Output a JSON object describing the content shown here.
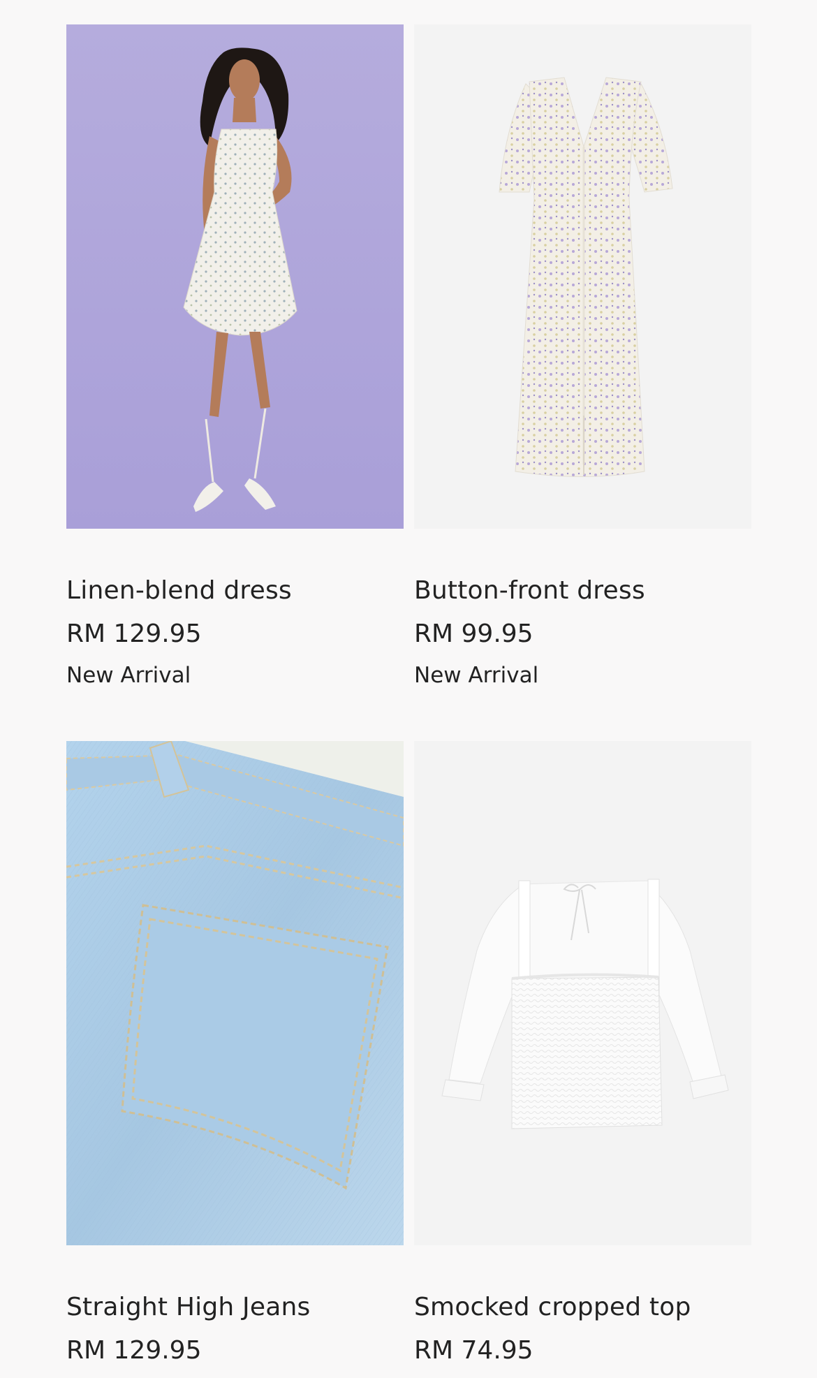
{
  "products": [
    {
      "name": "Linen-blend dress",
      "price": "RM 129.95",
      "badge": "New Arrival",
      "image_icon": "model-wearing-floral-dress-image",
      "image_bg": "#b8afdf"
    },
    {
      "name": "Button-front dress",
      "price": "RM 99.95",
      "badge": "New Arrival",
      "image_icon": "floral-button-front-dress-image",
      "image_bg": "#f3f3f3"
    },
    {
      "name": "Straight High Jeans",
      "price": "RM 129.95",
      "badge": "",
      "image_icon": "denim-back-pocket-image",
      "image_bg": "#a9c9e3"
    },
    {
      "name": "Smocked cropped top",
      "price": "RM 74.95",
      "badge": "",
      "image_icon": "white-smocked-top-image",
      "image_bg": "#f3f3f3"
    }
  ]
}
